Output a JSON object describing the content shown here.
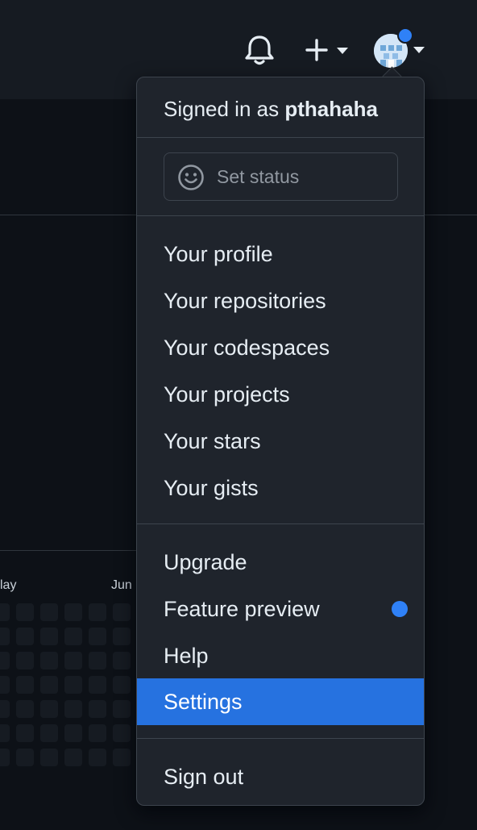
{
  "header": {
    "notifications_icon": "bell-icon",
    "create_icon": "plus-icon",
    "avatar_badge_color": "#2f81f7"
  },
  "background": {
    "month_labels": [
      "lay",
      "Jun"
    ]
  },
  "dropdown": {
    "signed_in_prefix": "Signed in as",
    "username": "pthahaha",
    "status": {
      "icon": "smiley-icon",
      "label": "Set status"
    },
    "group1": [
      {
        "label": "Your profile"
      },
      {
        "label": "Your repositories"
      },
      {
        "label": "Your codespaces"
      },
      {
        "label": "Your projects"
      },
      {
        "label": "Your stars"
      },
      {
        "label": "Your gists"
      }
    ],
    "group2": [
      {
        "label": "Upgrade"
      },
      {
        "label": "Feature preview"
      },
      {
        "label": "Help"
      },
      {
        "label": "Settings"
      }
    ],
    "sign_out": "Sign out",
    "selected_item": "Settings",
    "accent_color": "#2672e0"
  }
}
